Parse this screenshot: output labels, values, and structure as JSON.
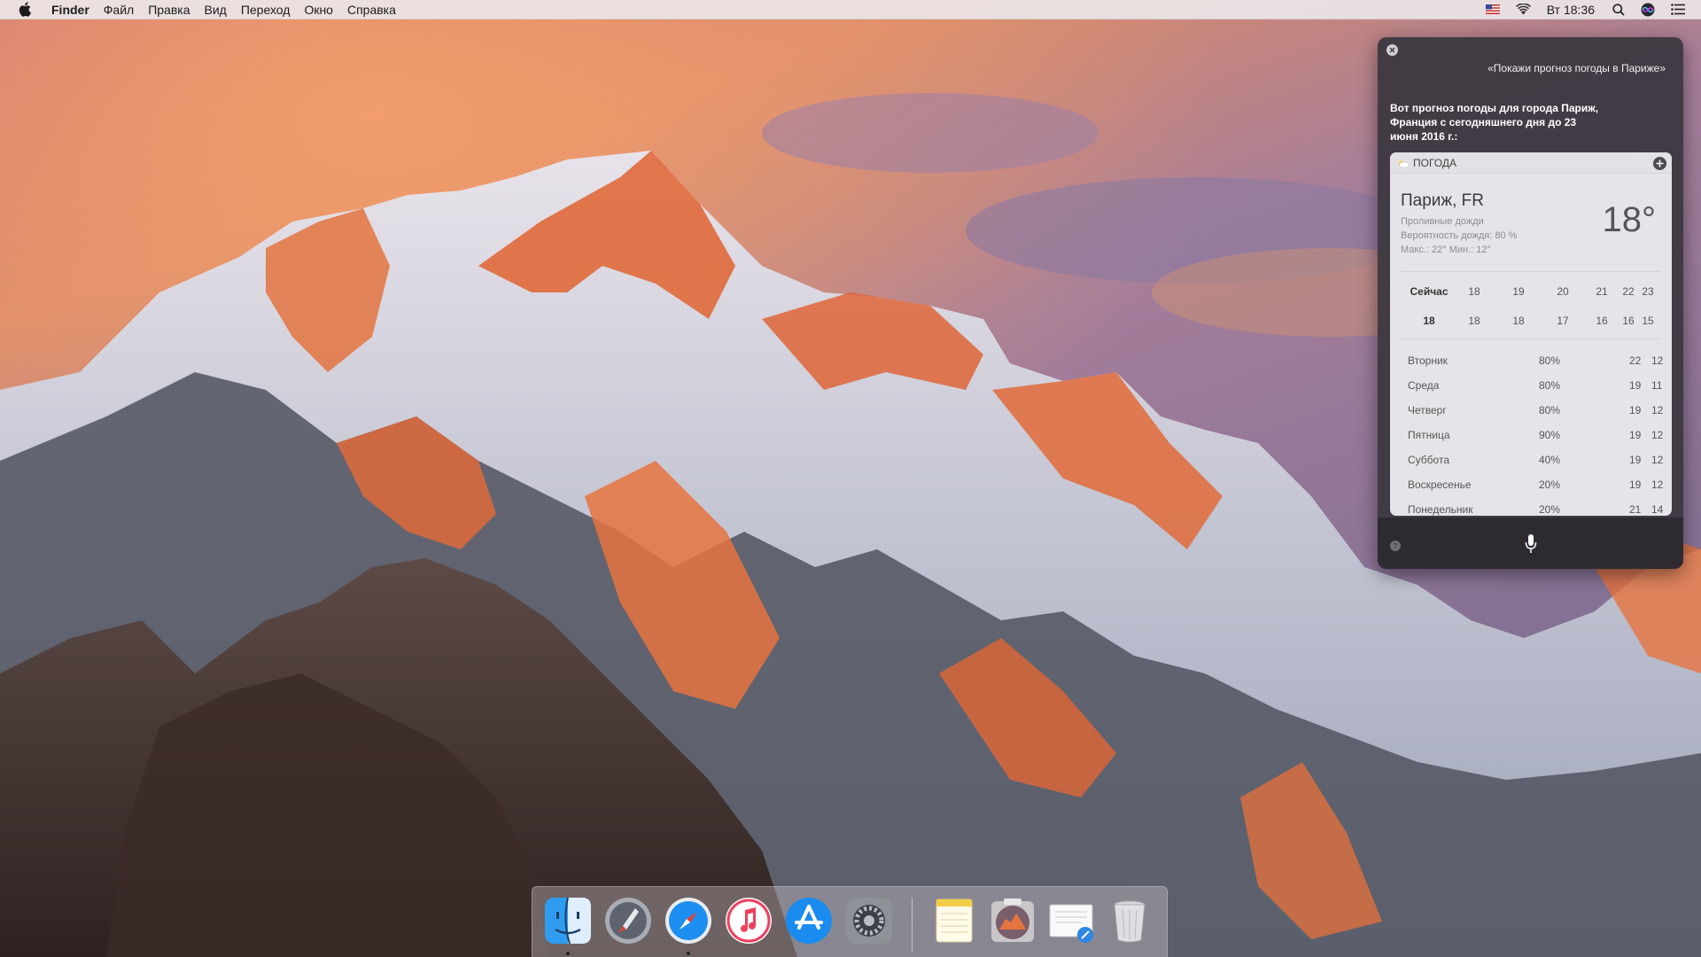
{
  "menubar": {
    "app_name": "Finder",
    "menus": [
      "Файл",
      "Правка",
      "Вид",
      "Переход",
      "Окно",
      "Справка"
    ],
    "clock": "Вт 18:36",
    "status_icons": [
      "flag-us-icon",
      "wifi-icon",
      "search-icon",
      "siri-icon",
      "notification-center-icon"
    ]
  },
  "siri": {
    "query": "«Покажи прогноз погоды в Париже»",
    "answer": "Вот прогноз погоды для города Париж, Франция с сегодняшнего дня до 23 июня 2016 г.:",
    "card": {
      "header": "ПОГОДА",
      "city": "Париж, FR",
      "condition": "Проливные дожди",
      "rain_chance": "Вероятность дождя: 80 %",
      "minmax": "Макс.: 22°  Мин.: 12°",
      "temperature": "18°",
      "hours": [
        "Сейчас",
        "18",
        "19",
        "20",
        "21",
        "22",
        "23"
      ],
      "hour_temps": [
        "18",
        "18",
        "18",
        "17",
        "16",
        "16",
        "15"
      ],
      "days": [
        {
          "name": "Вторник",
          "rain": "80%",
          "hi": "22",
          "lo": "12"
        },
        {
          "name": "Среда",
          "rain": "80%",
          "hi": "19",
          "lo": "11"
        },
        {
          "name": "Четверг",
          "rain": "80%",
          "hi": "19",
          "lo": "12"
        },
        {
          "name": "Пятница",
          "rain": "90%",
          "hi": "19",
          "lo": "12"
        },
        {
          "name": "Суббота",
          "rain": "40%",
          "hi": "19",
          "lo": "12"
        },
        {
          "name": "Воскресенье",
          "rain": "20%",
          "hi": "19",
          "lo": "12"
        },
        {
          "name": "Понедельник",
          "rain": "20%",
          "hi": "21",
          "lo": "14"
        }
      ]
    }
  },
  "dock": {
    "apps": [
      "finder-icon",
      "launchpad-icon",
      "safari-icon",
      "itunes-icon",
      "app-store-icon",
      "system-preferences-icon"
    ],
    "others": [
      "notes-icon",
      "macos-sierra-icon",
      "preview-document-icon",
      "trash-icon"
    ]
  }
}
